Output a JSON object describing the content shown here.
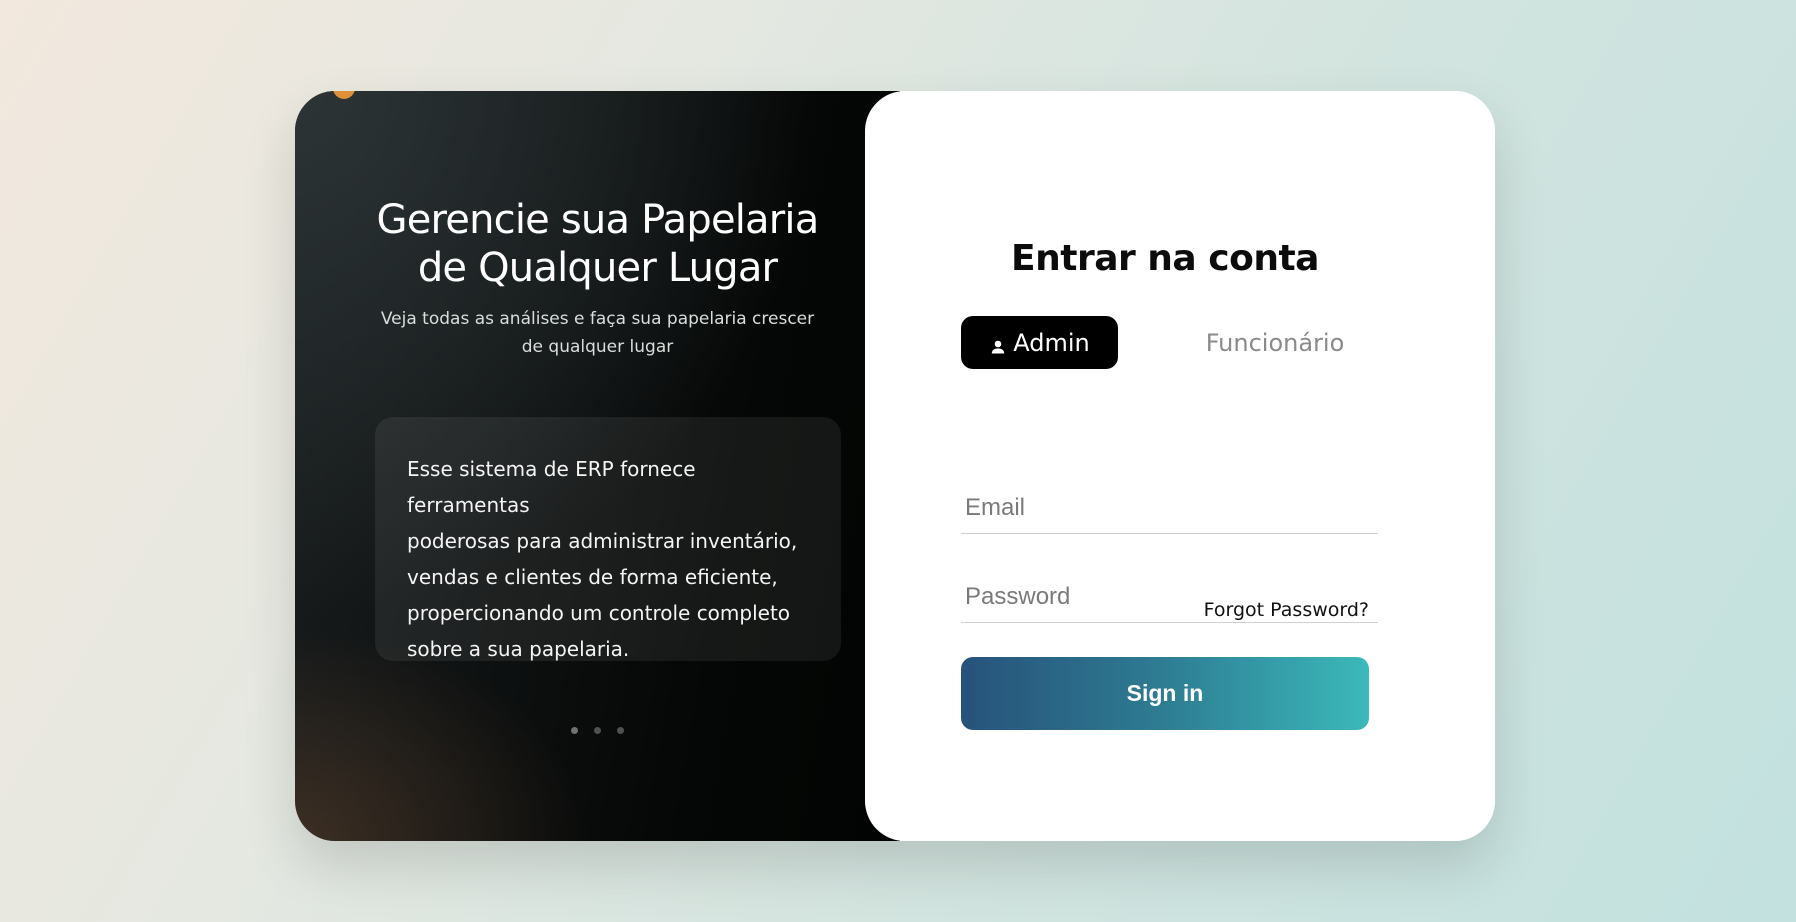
{
  "hero": {
    "title_line1": "Gerencie sua Papelaria",
    "title_line2": "de Qualquer Lugar",
    "subtitle_line1": "Veja todas as análises e faça sua papelaria crescer",
    "subtitle_line2": "de qualquer lugar",
    "description_lines": [
      "Esse sistema de ERP fornece ferramentas",
      "poderosas para administrar inventário,",
      "vendas e clientes de forma eficiente,",
      "propercionando um controle completo",
      "sobre a sua papelaria."
    ],
    "carousel": {
      "count": 3,
      "active_index": 0
    },
    "brand_color": "#e0903a"
  },
  "login": {
    "title": "Entrar na conta",
    "tabs": [
      {
        "label": "Admin",
        "icon": "user-icon",
        "active": true
      },
      {
        "label": "Funcionário",
        "active": false
      }
    ],
    "email": {
      "placeholder": "Email",
      "value": ""
    },
    "password": {
      "placeholder": "Password",
      "value": ""
    },
    "forgot_label": "Forgot Password?",
    "signin_label": "Sign in"
  },
  "colors": {
    "button_gradient_start": "#27527a",
    "button_gradient_end": "#3bb9ba",
    "active_tab": "#000000"
  }
}
